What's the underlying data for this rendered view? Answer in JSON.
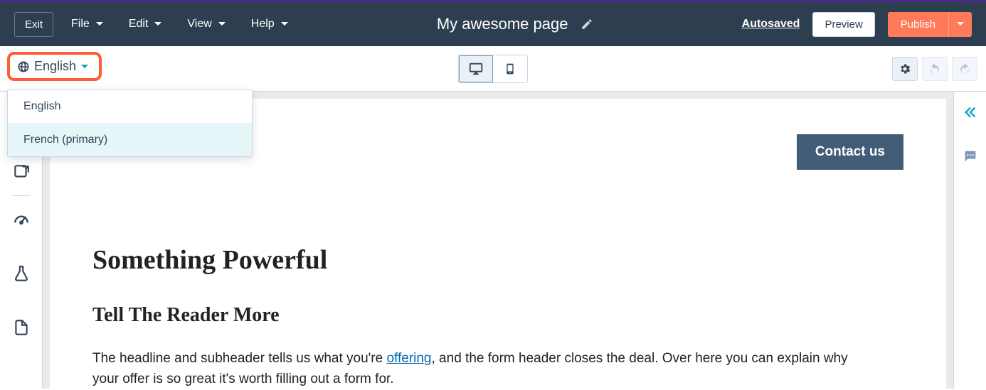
{
  "topbar": {
    "exit": "Exit",
    "menus": {
      "file": "File",
      "edit": "Edit",
      "view": "View",
      "help": "Help"
    },
    "page_title": "My awesome page",
    "autosaved": "Autosaved",
    "preview": "Preview",
    "publish": "Publish"
  },
  "subbar": {
    "language_selected": "English"
  },
  "language_dropdown": {
    "options": [
      {
        "label": "English",
        "highlighted": false
      },
      {
        "label": "French (primary)",
        "highlighted": true
      }
    ]
  },
  "content": {
    "cta": "Contact us",
    "h1": "Something Powerful",
    "h2": "Tell The Reader More",
    "p_before": "The headline and subheader tells us what you're ",
    "p_link": "offering",
    "p_after": ", and the form header closes the deal. Over here you can explain why your offer is so great it's worth filling out a form for."
  }
}
